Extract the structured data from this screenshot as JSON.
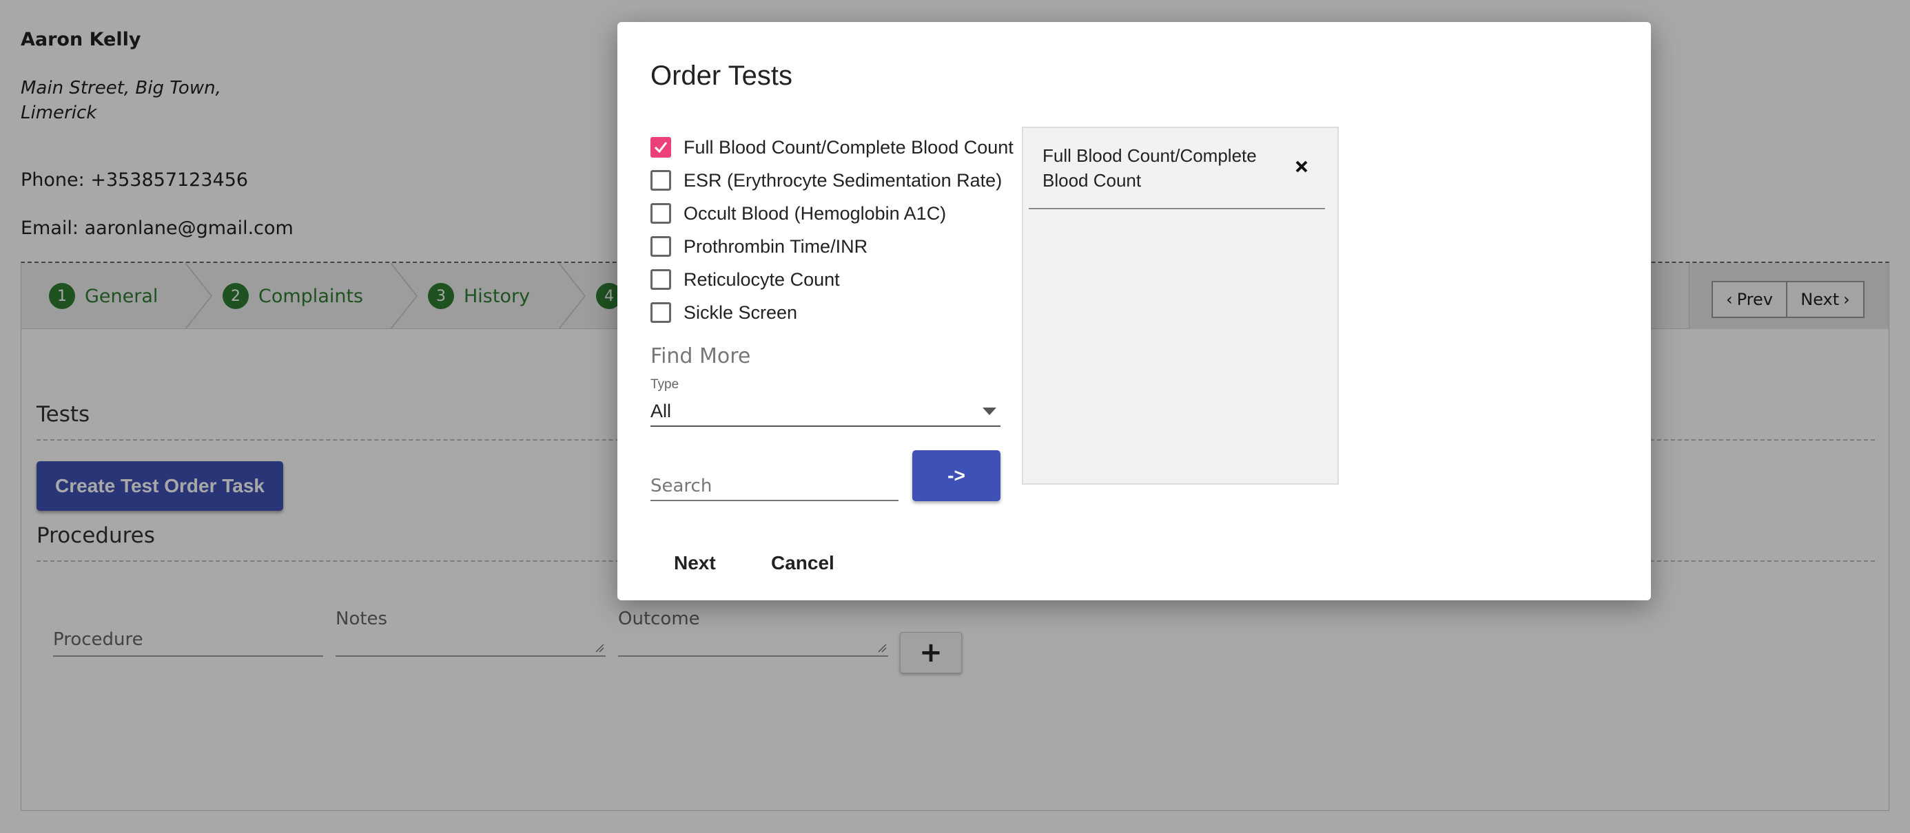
{
  "patient": {
    "name": "Aaron Kelly",
    "address_line1": "Main Street, Big Town,",
    "address_line2": "Limerick",
    "phone": "Phone: +353857123456",
    "email": "Email: aaronlane@gmail.com"
  },
  "steps": [
    {
      "num": "1",
      "label": "General"
    },
    {
      "num": "2",
      "label": "Complaints"
    },
    {
      "num": "3",
      "label": "History"
    },
    {
      "num": "4",
      "label": ""
    }
  ],
  "pager": {
    "prev": "Prev",
    "next": "Next"
  },
  "tests_section": {
    "title": "Tests",
    "create_button": "Create Test Order Task"
  },
  "procedures_section": {
    "title": "Procedures",
    "procedure_label": "Procedure",
    "notes_label": "Notes",
    "outcome_label": "Outcome",
    "add_button": "+"
  },
  "modal": {
    "title": "Order Tests",
    "tests": [
      {
        "label": "Full Blood Count/Complete Blood Count",
        "checked": true
      },
      {
        "label": "ESR (Erythrocyte Sedimentation Rate)",
        "checked": false
      },
      {
        "label": "Occult Blood (Hemoglobin A1C)",
        "checked": false
      },
      {
        "label": "Prothrombin Time/INR",
        "checked": false
      },
      {
        "label": "Reticulocyte Count",
        "checked": false
      },
      {
        "label": "Sickle Screen",
        "checked": false
      }
    ],
    "find_more": "Find More",
    "type_label": "Type",
    "type_value": "All",
    "search_placeholder": "Search",
    "go_button": "->",
    "selected": [
      {
        "label": "Full Blood Count/Complete Blood Count"
      }
    ],
    "next_button": "Next",
    "cancel_button": "Cancel"
  },
  "colors": {
    "primary": "#3f51b5",
    "step_green": "#2e7d32",
    "checkbox_checked": "#ec407a"
  }
}
